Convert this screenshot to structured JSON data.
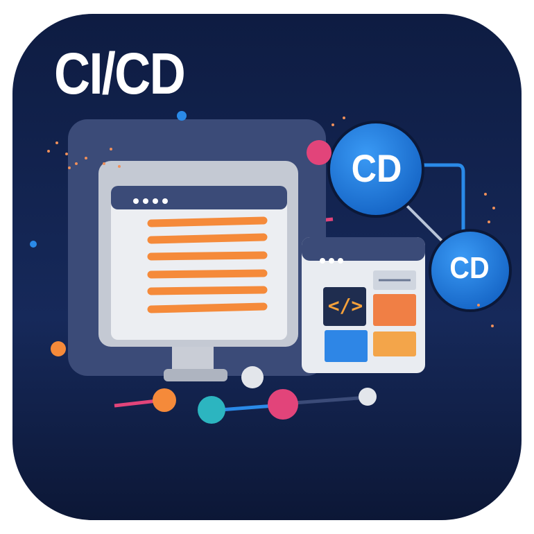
{
  "title": "CI/CD",
  "nodes": [
    {
      "label": "CD"
    },
    {
      "label": "CD"
    }
  ],
  "code_glyph": "</>",
  "colors": {
    "background": "#12224a",
    "accent_orange": "#f58a3a",
    "accent_pink": "#e2447a",
    "accent_blue": "#1e7de0",
    "accent_teal": "#2cb5c0"
  }
}
